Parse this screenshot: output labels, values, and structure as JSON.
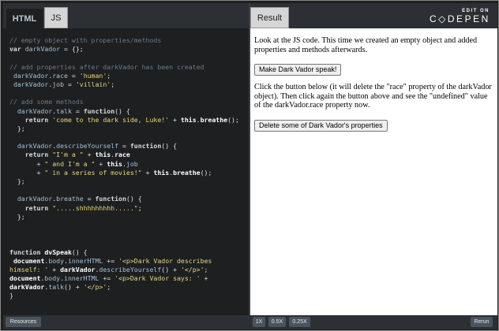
{
  "editor": {
    "tabs": [
      {
        "label": "HTML"
      },
      {
        "label": "JS"
      }
    ],
    "code_lines": [
      [
        [
          "c",
          "// empty object with properties/methods"
        ]
      ],
      [
        [
          "k",
          "var"
        ],
        [
          "o",
          " "
        ],
        [
          "v",
          "darkVador"
        ],
        [
          "o",
          " = {};"
        ]
      ],
      [
        [
          "o",
          ""
        ]
      ],
      [
        [
          "c",
          "// add properties after darkVador has been created"
        ]
      ],
      [
        [
          "o",
          " "
        ],
        [
          "v",
          "darkVador"
        ],
        [
          "o",
          "."
        ],
        [
          "p",
          "race"
        ],
        [
          "o",
          " = "
        ],
        [
          "s",
          "'human'"
        ],
        [
          "o",
          ";"
        ]
      ],
      [
        [
          "o",
          " "
        ],
        [
          "v",
          "darkVador"
        ],
        [
          "o",
          "."
        ],
        [
          "p",
          "job"
        ],
        [
          "o",
          " = "
        ],
        [
          "s",
          "'villain'"
        ],
        [
          "o",
          ";"
        ]
      ],
      [
        [
          "o",
          ""
        ]
      ],
      [
        [
          "c",
          "// add some methods"
        ]
      ],
      [
        [
          "o",
          "  "
        ],
        [
          "v",
          "darkVador"
        ],
        [
          "o",
          "."
        ],
        [
          "p",
          "talk"
        ],
        [
          "o",
          " = "
        ],
        [
          "k",
          "function"
        ],
        [
          "o",
          "() {"
        ]
      ],
      [
        [
          "o",
          "    "
        ],
        [
          "k",
          "return"
        ],
        [
          "o",
          " "
        ],
        [
          "s",
          "'come to the dark side, Luke!'"
        ],
        [
          "o",
          " + "
        ],
        [
          "b",
          "this"
        ],
        [
          "o",
          "."
        ],
        [
          "b",
          "breathe"
        ],
        [
          "o",
          "();"
        ]
      ],
      [
        [
          "o",
          "  };"
        ]
      ],
      [
        [
          "o",
          ""
        ]
      ],
      [
        [
          "o",
          "  "
        ],
        [
          "v",
          "darkVador"
        ],
        [
          "o",
          "."
        ],
        [
          "p",
          "describeYourself"
        ],
        [
          "o",
          " = "
        ],
        [
          "k",
          "function"
        ],
        [
          "o",
          "() {"
        ]
      ],
      [
        [
          "o",
          "    "
        ],
        [
          "k",
          "return"
        ],
        [
          "o",
          " "
        ],
        [
          "s",
          "\"I'm a \""
        ],
        [
          "o",
          " + "
        ],
        [
          "b",
          "this"
        ],
        [
          "o",
          "."
        ],
        [
          "b",
          "race"
        ]
      ],
      [
        [
          "o",
          "       + "
        ],
        [
          "s",
          "\" and I'm a \""
        ],
        [
          "o",
          " + "
        ],
        [
          "b",
          "this"
        ],
        [
          "o",
          "."
        ],
        [
          "p",
          "job"
        ]
      ],
      [
        [
          "o",
          "       + "
        ],
        [
          "s",
          "\" in a series of movies!\""
        ],
        [
          "o",
          " + "
        ],
        [
          "b",
          "this"
        ],
        [
          "o",
          "."
        ],
        [
          "b",
          "breathe"
        ],
        [
          "o",
          "();"
        ]
      ],
      [
        [
          "o",
          "  };"
        ]
      ],
      [
        [
          "o",
          ""
        ]
      ],
      [
        [
          "o",
          "  "
        ],
        [
          "v",
          "darkVador"
        ],
        [
          "o",
          "."
        ],
        [
          "p",
          "breathe"
        ],
        [
          "o",
          " = "
        ],
        [
          "k",
          "function"
        ],
        [
          "o",
          "() {"
        ]
      ],
      [
        [
          "o",
          "    "
        ],
        [
          "k",
          "return"
        ],
        [
          "o",
          " "
        ],
        [
          "s",
          "\".....shhhhhhhhh.....\""
        ],
        [
          "o",
          ";"
        ]
      ],
      [
        [
          "o",
          "  };"
        ]
      ],
      [
        [
          "o",
          ""
        ]
      ],
      [
        [
          "o",
          ""
        ]
      ],
      [
        [
          "o",
          ""
        ]
      ],
      [
        [
          "k",
          "function"
        ],
        [
          "o",
          " "
        ],
        [
          "b",
          "dvSpeak"
        ],
        [
          "o",
          "() {"
        ]
      ],
      [
        [
          "o",
          " "
        ],
        [
          "b",
          "document"
        ],
        [
          "o",
          "."
        ],
        [
          "p",
          "body"
        ],
        [
          "o",
          "."
        ],
        [
          "p",
          "innerHTML"
        ],
        [
          "o",
          " += "
        ],
        [
          "s",
          "'<p>Dark Vador describes"
        ]
      ],
      [
        [
          "s",
          "himself: '"
        ],
        [
          "o",
          " + "
        ],
        [
          "b",
          "darkVador"
        ],
        [
          "o",
          "."
        ],
        [
          "p",
          "describeYourself"
        ],
        [
          "o",
          "() + "
        ],
        [
          "s",
          "'</p>'"
        ],
        [
          "o",
          ";"
        ]
      ],
      [
        [
          "b",
          "document"
        ],
        [
          "o",
          "."
        ],
        [
          "p",
          "body"
        ],
        [
          "o",
          "."
        ],
        [
          "p",
          "innerHTML"
        ],
        [
          "o",
          " += "
        ],
        [
          "s",
          "'<p>Dark Vador says: '"
        ],
        [
          "o",
          " +"
        ]
      ],
      [
        [
          "b",
          "darkVador"
        ],
        [
          "o",
          "."
        ],
        [
          "p",
          "talk"
        ],
        [
          "o",
          "() + "
        ],
        [
          "s",
          "'</p>'"
        ],
        [
          "o",
          ";"
        ]
      ],
      [
        [
          "o",
          "}"
        ]
      ]
    ]
  },
  "result": {
    "tab_label": "Result",
    "brand_top": "EDIT ON",
    "brand_main": "C◇DEPEN",
    "paragraph1": "Look at the JS code. This time we created an empty object and added properties and methods afterwards.",
    "button1": "Make Dark Vador speak!",
    "paragraph2": "Click the button below (it will delete the \"race\" property of the darkVador object). Then click again the button above and see the \"undefined\" value of the darkVador.race property now.",
    "button2": "Delete some of Dark Vador's properties"
  },
  "bottom": {
    "resources": "Resources",
    "zoom": [
      "1X",
      "0.5X",
      "0.25X"
    ],
    "rerun": "Rerun"
  }
}
